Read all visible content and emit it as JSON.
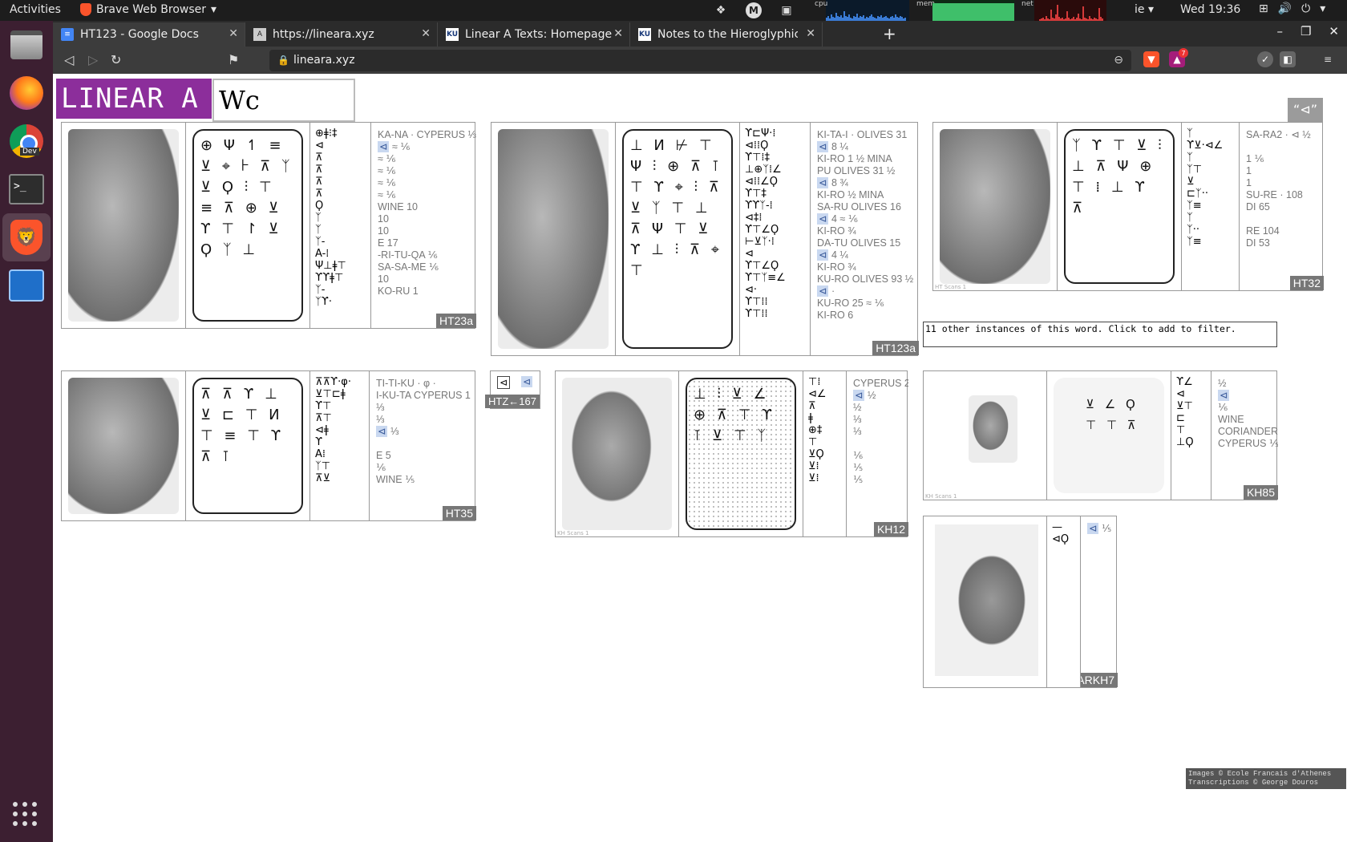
{
  "topbar": {
    "activities": "Activities",
    "app_name": "Brave Web Browser",
    "cpu_label": "cpu",
    "mem_label": "mem",
    "net_label": "net",
    "lang": "ie",
    "clock": "Wed 19:36"
  },
  "dock": {
    "items": [
      "Files",
      "Firefox",
      "Chrome Dev",
      "Terminal",
      "Brave",
      "System Monitor"
    ],
    "chrome_badge": "Dev",
    "terminal_prompt": ">_"
  },
  "browser": {
    "tabs": [
      {
        "title": "HT123 - Google Docs",
        "icon": "google-docs-icon"
      },
      {
        "title": "https://lineara.xyz",
        "icon": "linear-a-icon"
      },
      {
        "title": "Linear A Texts: Homepage",
        "icon": "ku-icon"
      },
      {
        "title": "Notes to the Hieroglyphic S",
        "icon": "ku-icon"
      }
    ],
    "url": "lineara.xyz",
    "shield_count": "7"
  },
  "page": {
    "brand": "LINEAR A",
    "search_value": "Wc",
    "quote_button": "“⊲”",
    "instances_text": "11 other instances of this word. Click to add to filter.",
    "footer_credit_1": "Images © Ecole Francais d'Athenes",
    "footer_credit_2": "Transcriptions © George Douros",
    "cards": [
      {
        "id": "HT23a",
        "label": "HT23a",
        "transliteration": [
          "KA-NA · CYPERUS ⅓",
          "⊲ ≈ ⅙",
          "≈ ⅙",
          "≈ ⅙",
          "≈ ⅙",
          "≈ ⅙",
          "WINE 10",
          "10",
          "10",
          "E 17",
          "-RI-TU-QA ⅙",
          "SA-SA-ME ⅙",
          "10",
          "KO-RU 1"
        ]
      },
      {
        "id": "HT123a",
        "label": "HT123a",
        "transliteration": [
          "KI-TA-I · OLIVES 31",
          "⊲ 8 ¼",
          "KI-RO 1 ½ MINA",
          "PU OLIVES 31 ½",
          "⊲ 8 ¾",
          "KI-RO ½ MINA",
          "SA-RU OLIVES 16",
          "⊲ 4 ≈ ⅙",
          "KI-RO ¾",
          "DA-TU OLIVES 15",
          "⊲ 4 ¼",
          "KI-RO ¾",
          "KU-RO OLIVES 93 ½",
          "⊲ ·",
          "KU-RO 25 ≈ ⅙",
          "KI-RO 6"
        ]
      },
      {
        "id": "HT32",
        "label": "HT32",
        "credit": "HT Scans 1",
        "transliteration": [
          "SA-RA2 · ⊲ ½",
          "",
          "1 ⅙",
          "1",
          "1",
          "SU-RE · 108",
          "DI 65",
          "",
          "RE 104",
          "DI 53"
        ]
      },
      {
        "id": "HT35",
        "label": "HT35",
        "transliteration": [
          "TI-TI-KU · φ ·",
          "I-KU-TA CYPERUS 1",
          "⅓",
          "⅓",
          "⊲ ⅓",
          "",
          "E 5",
          "⅙",
          "WINE ⅕"
        ]
      },
      {
        "id": "HTZ167",
        "label": "HTZ←167"
      },
      {
        "id": "KH12",
        "label": "KH12",
        "credit": "KH Scans 1",
        "transliteration": [
          "CYPERUS 2",
          "⊲ ½",
          "½",
          "⅓",
          "⅓",
          "",
          "⅙",
          "⅕",
          "⅕",
          "",
          ""
        ]
      },
      {
        "id": "KH85",
        "label": "KH85",
        "credit": "KH Scans 1",
        "transliteration": [
          "½",
          "⊲",
          "⅙",
          "WINE",
          "CORIANDER?",
          "CYPERUS ⅕"
        ]
      },
      {
        "id": "ARKH7",
        "label": "ARKH7",
        "transliteration": [
          "⊲ ⅕"
        ]
      }
    ]
  }
}
